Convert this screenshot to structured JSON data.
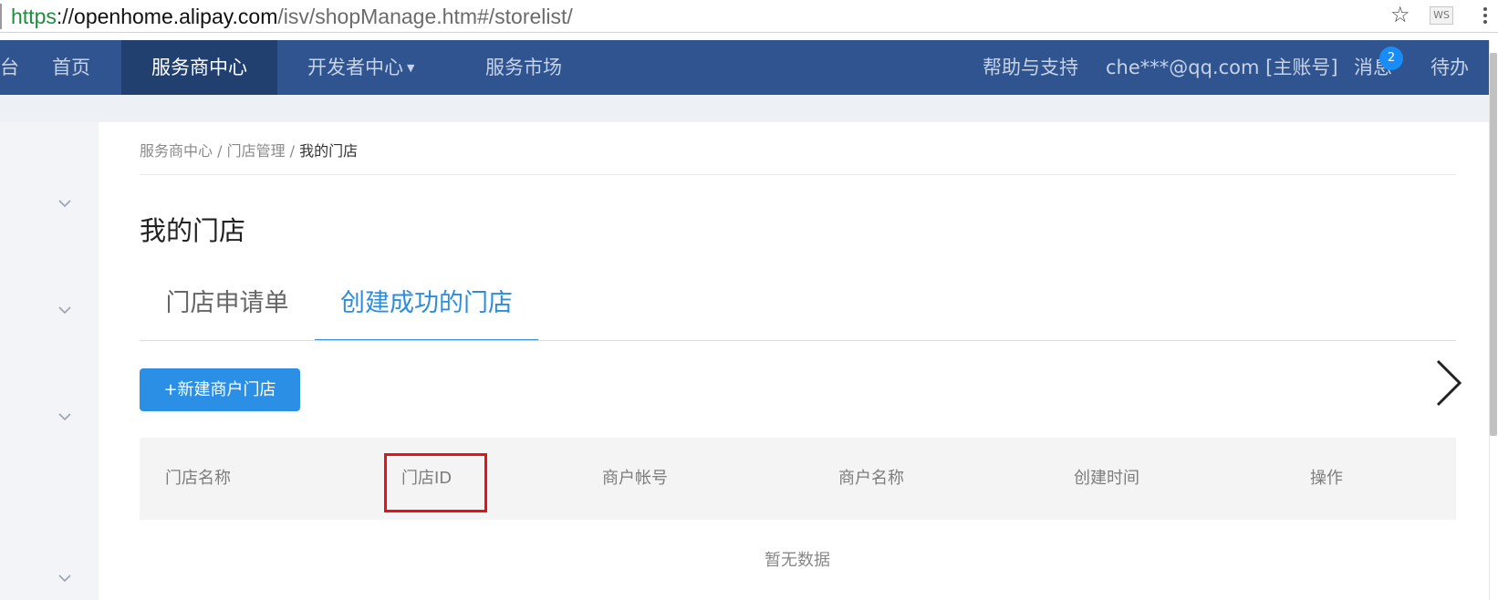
{
  "browser": {
    "url_scheme": "https",
    "url_sep": "://",
    "url_host": "openhome.alipay.com",
    "url_path": "/isv/shopManage.htm#/storelist/",
    "extension_label": "WS"
  },
  "topnav": {
    "items": [
      {
        "label": "台"
      },
      {
        "label": "首页"
      },
      {
        "label": "服务商中心"
      },
      {
        "label": "开发者中心"
      },
      {
        "label": "服务市场"
      }
    ],
    "help": "帮助与支持",
    "account": "che***@qq.com [主账号]",
    "messages": "消息",
    "message_count": "2",
    "todo": "待办",
    "active_bg": "#21406f",
    "bar_bg": "#2f5490"
  },
  "breadcrumb": {
    "level1": "服务商中心",
    "sep": " / ",
    "level2": "门店管理",
    "current": "我的门店"
  },
  "page": {
    "title": "我的门店",
    "tabs": [
      {
        "label": "门店申请单",
        "active": false
      },
      {
        "label": "创建成功的门店",
        "active": true
      }
    ],
    "new_button": "+新建商户门店",
    "accent": "#2b90e5"
  },
  "table": {
    "columns": [
      "门店名称",
      "门店ID",
      "商户帐号",
      "商户名称",
      "创建时间",
      "操作"
    ],
    "highlighted_column": "门店ID",
    "highlight_color": "#e8101a",
    "empty_text": "暂无数据"
  }
}
